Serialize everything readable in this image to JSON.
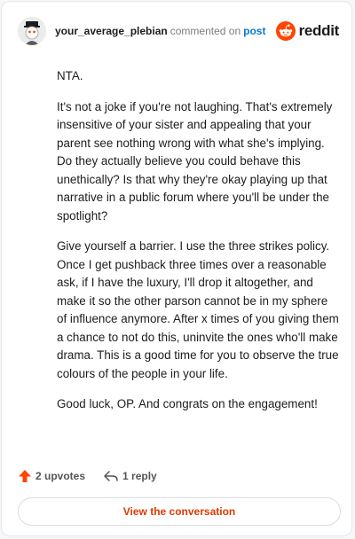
{
  "header": {
    "username": "your_average_plebian",
    "verb": "commented on",
    "post_link": "post",
    "brand": "reddit"
  },
  "comment": {
    "paragraphs": [
      "NTA.",
      "It's not a joke if you're not laughing. That's extremely insensitive of your sister and appealing that your parent see nothing wrong with what she's implying. Do they actually believe you could behave this unethically? Is that why they're okay playing up that narrative in a public forum where you'll be under the spotlight?",
      "Give yourself a barrier. I use the three strikes policy. Once I get pushback three times over a reasonable ask, if I have the luxury, I'll drop it altogether, and make it so the other parson cannot be in my sphere of influence anymore. After x times of you giving them a chance to not do this, uninvite the ones who'll make drama. This is a good time for you to observe the true colours of the people in your life.",
      "Good luck, OP. And congrats on the engagement!"
    ]
  },
  "actions": {
    "upvotes": "2 upvotes",
    "replies": "1 reply"
  },
  "view_button": "View the conversation",
  "colors": {
    "accent": "#ff4500",
    "link": "#0079d3",
    "button_text": "#d93a00"
  }
}
